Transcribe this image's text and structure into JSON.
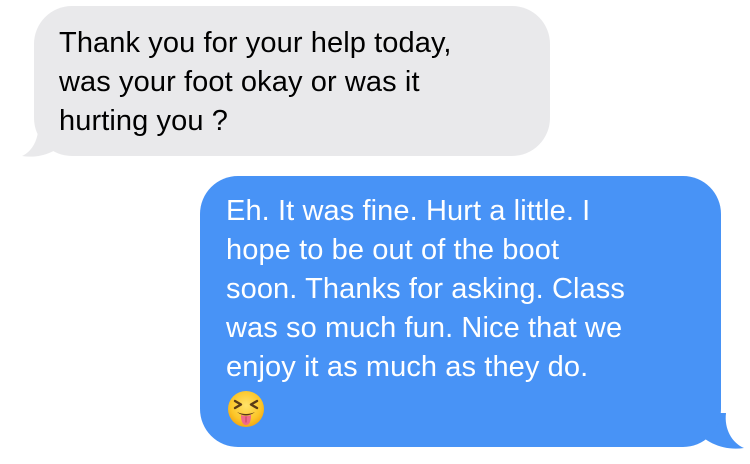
{
  "conversation": {
    "incoming": {
      "lines": [
        "Thank you for your help today,",
        "was your foot okay or was it",
        "hurting you ?"
      ]
    },
    "outgoing": {
      "lines": [
        "Eh. It was fine. Hurt a little. I",
        "hope to be out of the boot",
        "soon. Thanks for asking. Class",
        "was so much fun. Nice that we",
        "enjoy it as much as they do."
      ],
      "emoji": "squinting-face-with-tongue"
    }
  },
  "colors": {
    "incoming_bubble": "#e9e9eb",
    "outgoing_bubble": "#4893f6",
    "incoming_text": "#000000",
    "outgoing_text": "#ffffff"
  }
}
